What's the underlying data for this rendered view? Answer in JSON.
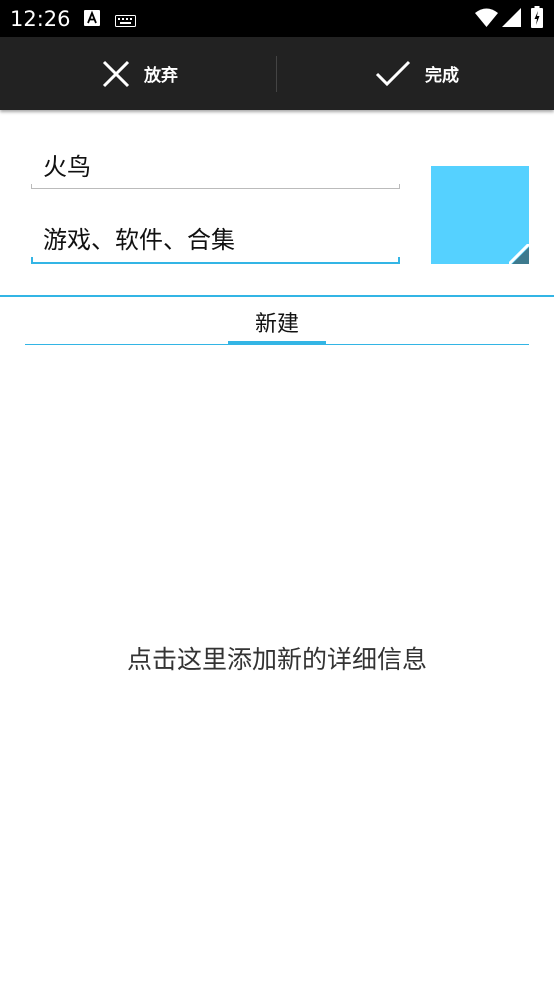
{
  "status_bar": {
    "time": "12:26",
    "icons": [
      "text-a-icon",
      "keyboard-icon",
      "wifi-icon",
      "cell-signal-icon",
      "battery-icon"
    ]
  },
  "action_bar": {
    "discard_label": "放弃",
    "done_label": "完成",
    "discard_icon": "close-icon",
    "done_icon": "check-icon"
  },
  "form": {
    "name_value": "火鸟",
    "tags_value": "游戏、软件、合集",
    "swatch_color": "#55d1ff",
    "accent_color": "#33b5e5"
  },
  "tabs": [
    {
      "label": "新建",
      "selected": true
    }
  ],
  "main": {
    "empty_hint": "点击这里添加新的详细信息"
  }
}
